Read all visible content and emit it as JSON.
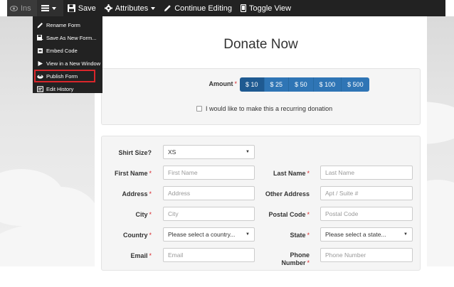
{
  "toolbar": {
    "ins_label": "Ins",
    "save_label": "Save",
    "attributes_label": "Attributes",
    "continue_label": "Continue Editing",
    "toggle_label": "Toggle View"
  },
  "menu": {
    "items": [
      {
        "label": "Rename Form",
        "icon": "pencil-icon"
      },
      {
        "label": "Save As New Form...",
        "icon": "save-as-icon"
      },
      {
        "label": "Embed Code",
        "icon": "embed-icon"
      },
      {
        "label": "View in a New Window",
        "icon": "play-icon"
      },
      {
        "label": "Publish Form",
        "icon": "cloud-upload-icon"
      },
      {
        "label": "Edit History",
        "icon": "history-icon"
      }
    ],
    "highlight_color": "#d9262b"
  },
  "form": {
    "title": "Donate Now",
    "amount_label": "Amount",
    "required_mark": "*",
    "amounts": [
      "$ 10",
      "$ 25",
      "$ 50",
      "$ 100",
      "$ 500"
    ],
    "selected_amount": "$ 10",
    "recurring_label": "I would like to make this a recurring donation",
    "shirt_label": "Shirt Size?",
    "shirt_value": "XS",
    "first_name_label": "First Name",
    "first_name_placeholder": "First Name",
    "last_name_label": "Last Name",
    "last_name_placeholder": "Last Name",
    "address_label": "Address",
    "address_placeholder": "Address",
    "other_address_label": "Other Address",
    "other_address_placeholder": "Apt / Suite #",
    "city_label": "City",
    "city_placeholder": "City",
    "postal_label": "Postal Code",
    "postal_placeholder": "Postal Code",
    "country_label": "Country",
    "country_value": "Please select a country...",
    "state_label": "State",
    "state_value": "Please select a state...",
    "email_label": "Email",
    "email_placeholder": "Email",
    "phone_label_1": "Phone",
    "phone_label_2": "Number",
    "phone_placeholder": "Phone Number"
  },
  "colors": {
    "toolbar_bg": "#222222",
    "button_primary": "#2f75b5",
    "button_selected": "#1f5a91"
  }
}
